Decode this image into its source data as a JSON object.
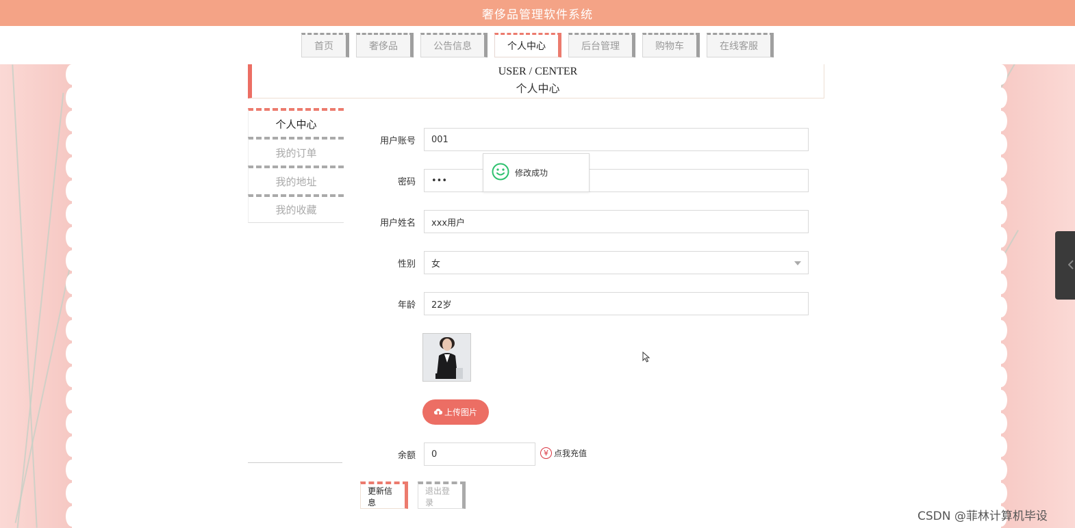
{
  "app": {
    "title": "奢侈品管理软件系统"
  },
  "nav": {
    "items": [
      {
        "label": "首页"
      },
      {
        "label": "奢侈品"
      },
      {
        "label": "公告信息"
      },
      {
        "label": "个人中心"
      },
      {
        "label": "后台管理"
      },
      {
        "label": "购物车"
      },
      {
        "label": "在线客服"
      }
    ],
    "active_index": 3
  },
  "breadcrumb": {
    "en": "USER / CENTER",
    "cn": "个人中心"
  },
  "side_menu": {
    "items": [
      {
        "label": "个人中心"
      },
      {
        "label": "我的订单"
      },
      {
        "label": "我的地址"
      },
      {
        "label": "我的收藏"
      }
    ]
  },
  "form": {
    "account": {
      "label": "用户账号",
      "value": "001"
    },
    "password": {
      "label": "密码",
      "value": "•••"
    },
    "name": {
      "label": "用户姓名",
      "value": "xxx用户"
    },
    "gender": {
      "label": "性别",
      "value": "女"
    },
    "age": {
      "label": "年龄",
      "value": "22岁"
    },
    "upload_label": "上传图片",
    "balance": {
      "label": "余额",
      "value": "0"
    },
    "recharge_label": "点我充值",
    "update_label": "更新信息",
    "logout_label": "退出登录"
  },
  "toast": {
    "message": "修改成功"
  },
  "watermark": "CSDN @菲林计算机毕设",
  "colors": {
    "header": "#f4a386",
    "accent": "#ec6e64",
    "background_side": "#f9d3cf",
    "success": "#2ec16e"
  }
}
